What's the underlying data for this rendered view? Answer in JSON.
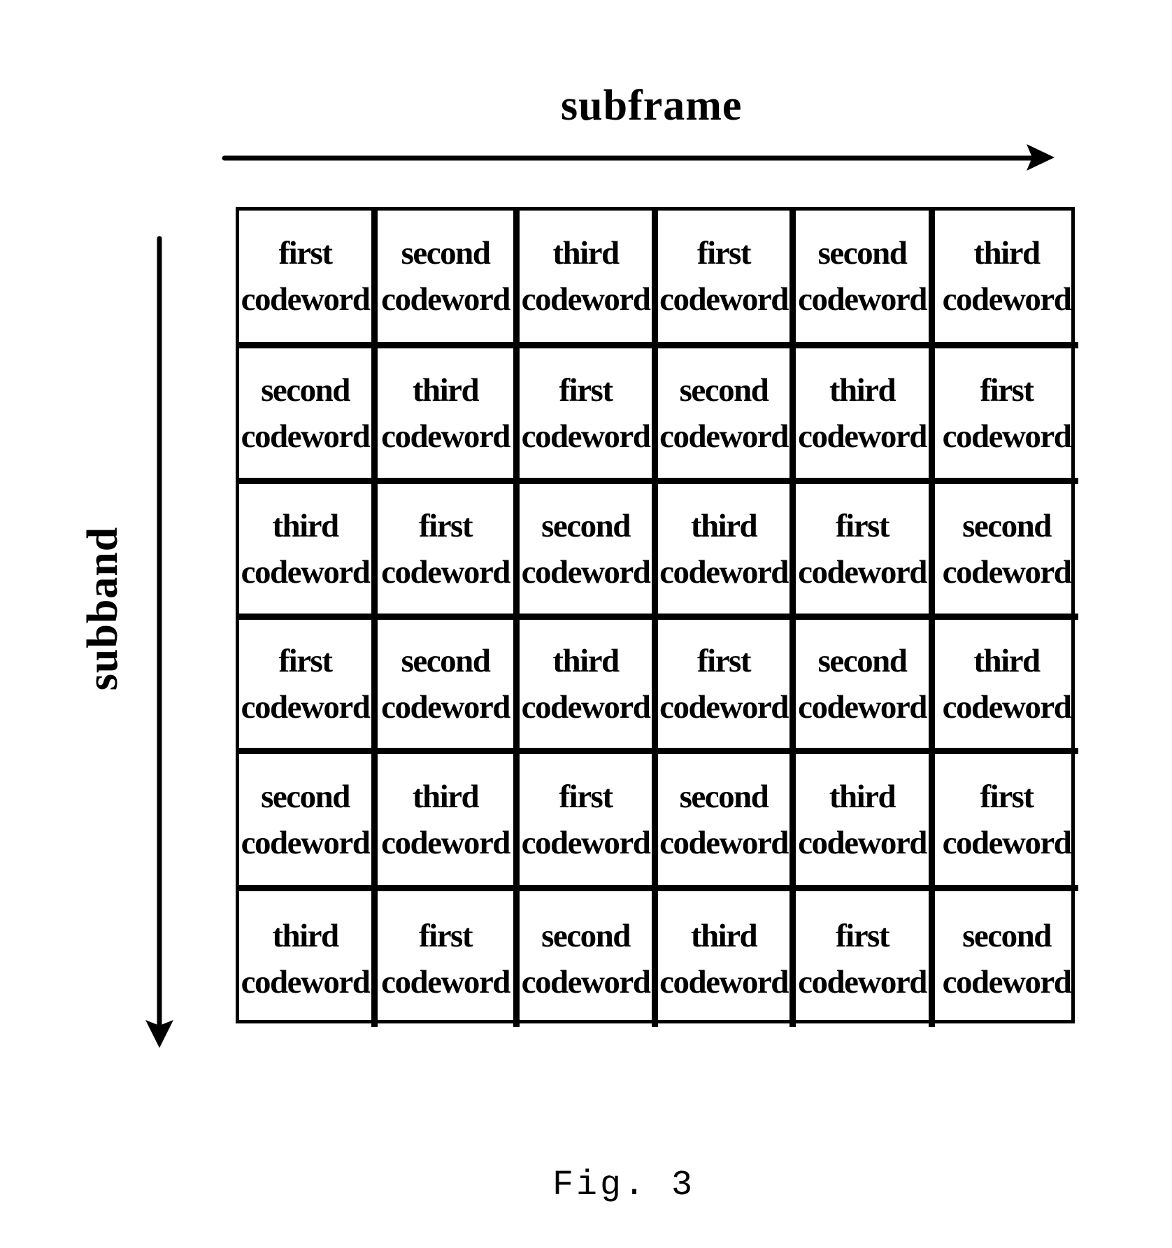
{
  "axes": {
    "horizontal_label": "subframe",
    "vertical_label": "subband",
    "horizontal_direction": "right",
    "vertical_direction": "down"
  },
  "grid": {
    "rows": 6,
    "columns": 6,
    "cells": [
      [
        {
          "ordinal": "first",
          "unit": "codeword"
        },
        {
          "ordinal": "second",
          "unit": "codeword"
        },
        {
          "ordinal": "third",
          "unit": "codeword"
        },
        {
          "ordinal": "first",
          "unit": "codeword"
        },
        {
          "ordinal": "second",
          "unit": "codeword"
        },
        {
          "ordinal": "third",
          "unit": "codeword"
        }
      ],
      [
        {
          "ordinal": "second",
          "unit": "codeword"
        },
        {
          "ordinal": "third",
          "unit": "codeword"
        },
        {
          "ordinal": "first",
          "unit": "codeword"
        },
        {
          "ordinal": "second",
          "unit": "codeword"
        },
        {
          "ordinal": "third",
          "unit": "codeword"
        },
        {
          "ordinal": "first",
          "unit": "codeword"
        }
      ],
      [
        {
          "ordinal": "third",
          "unit": "codeword"
        },
        {
          "ordinal": "first",
          "unit": "codeword"
        },
        {
          "ordinal": "second",
          "unit": "codeword"
        },
        {
          "ordinal": "third",
          "unit": "codeword"
        },
        {
          "ordinal": "first",
          "unit": "codeword"
        },
        {
          "ordinal": "second",
          "unit": "codeword"
        }
      ],
      [
        {
          "ordinal": "first",
          "unit": "codeword"
        },
        {
          "ordinal": "second",
          "unit": "codeword"
        },
        {
          "ordinal": "third",
          "unit": "codeword"
        },
        {
          "ordinal": "first",
          "unit": "codeword"
        },
        {
          "ordinal": "second",
          "unit": "codeword"
        },
        {
          "ordinal": "third",
          "unit": "codeword"
        }
      ],
      [
        {
          "ordinal": "second",
          "unit": "codeword"
        },
        {
          "ordinal": "third",
          "unit": "codeword"
        },
        {
          "ordinal": "first",
          "unit": "codeword"
        },
        {
          "ordinal": "second",
          "unit": "codeword"
        },
        {
          "ordinal": "third",
          "unit": "codeword"
        },
        {
          "ordinal": "first",
          "unit": "codeword"
        }
      ],
      [
        {
          "ordinal": "third",
          "unit": "codeword"
        },
        {
          "ordinal": "first",
          "unit": "codeword"
        },
        {
          "ordinal": "second",
          "unit": "codeword"
        },
        {
          "ordinal": "third",
          "unit": "codeword"
        },
        {
          "ordinal": "first",
          "unit": "codeword"
        },
        {
          "ordinal": "second",
          "unit": "codeword"
        }
      ]
    ]
  },
  "caption": "Fig. 3",
  "colors": {
    "ink": "#000000",
    "background": "#ffffff"
  }
}
